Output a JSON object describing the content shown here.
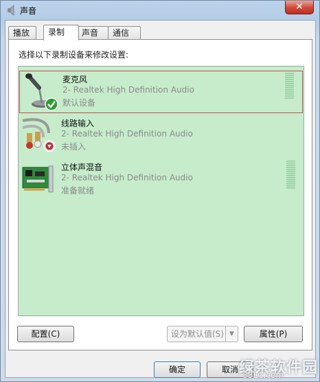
{
  "window": {
    "title": "声音",
    "close_glyph": "✕"
  },
  "tabs": [
    {
      "label": "播放"
    },
    {
      "label": "录制"
    },
    {
      "label": "声音"
    },
    {
      "label": "通信"
    }
  ],
  "panel": {
    "instruction": "选择以下录制设备来修改设置:"
  },
  "devices": [
    {
      "name": "麦克风",
      "driver": "2- Realtek High Definition Audio",
      "status": "默认设备",
      "icon": "microphone-icon",
      "badge": "default-check-icon",
      "selected": true,
      "level": 0
    },
    {
      "name": "线路输入",
      "driver": "2- Realtek High Definition Audio",
      "status": "未插入",
      "icon": "line-in-cable-icon",
      "badge": "unplugged-icon",
      "selected": false
    },
    {
      "name": "立体声混音",
      "driver": "2- Realtek High Definition Audio",
      "status": "准备就绪",
      "icon": "sound-card-icon",
      "selected": false,
      "level": 0
    }
  ],
  "buttons": {
    "configure": "配置(C)",
    "set_default": "设为默认值(S)",
    "properties": "属性(P)",
    "ok": "确定",
    "cancel": "取消"
  },
  "watermark": {
    "text": "绿茶软件园",
    "sub": "33LC.com"
  },
  "colors": {
    "list_bg": "#c6eccb",
    "selection_border": "#c0504d",
    "check_green": "#2e9c35"
  }
}
